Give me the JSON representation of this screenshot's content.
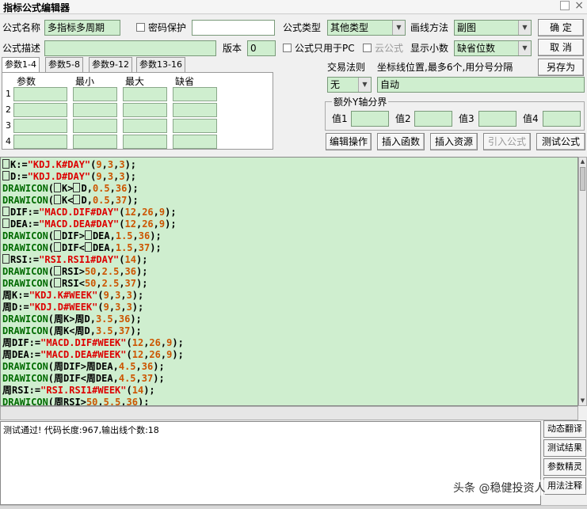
{
  "window": {
    "title": "指标公式编辑器"
  },
  "form": {
    "name_label": "公式名称",
    "name_value": "多指标多周期",
    "password_label": "密码保护",
    "desc_label": "公式描述",
    "version_label": "版本",
    "version_value": "0",
    "type_label": "公式类型",
    "type_value": "其他类型",
    "draw_label": "画线方法",
    "draw_value": "副图",
    "pc_only_label": "公式只用于PC",
    "cloud_label": "云公式",
    "decimals_label": "显示小数",
    "decimals_value": "缺省位数",
    "trade_rule_label": "交易法则",
    "trade_rule_value": "无",
    "coord_label": "坐标线位置,最多6个,用分号分隔",
    "coord_value": "自动",
    "yaxis_group": "额外Y轴分界",
    "val1_label": "值1",
    "val2_label": "值2",
    "val3_label": "值3",
    "val4_label": "值4"
  },
  "buttons": {
    "ok": "确  定",
    "cancel": "取  消",
    "save_as": "另存为",
    "edit_op": "编辑操作",
    "insert_fn": "插入函数",
    "insert_res": "插入资源",
    "import_formula": "引入公式",
    "test_formula": "测试公式"
  },
  "tabs": [
    "参数1-4",
    "参数5-8",
    "参数9-12",
    "参数13-16"
  ],
  "params": {
    "headers": [
      "参数",
      "最小",
      "最大",
      "缺省"
    ],
    "rows": [
      "1",
      "2",
      "3",
      "4"
    ]
  },
  "code_lines": [
    [
      [
        "box",
        ""
      ],
      [
        "id",
        "K:="
      ],
      [
        "str",
        "\"KDJ.K#DAY\""
      ],
      [
        "op",
        "("
      ],
      [
        "num",
        "9"
      ],
      [
        "op",
        ","
      ],
      [
        "num",
        "3"
      ],
      [
        "op",
        ","
      ],
      [
        "num",
        "3"
      ],
      [
        "op",
        ");"
      ]
    ],
    [
      [
        "box",
        ""
      ],
      [
        "id",
        "D:="
      ],
      [
        "str",
        "\"KDJ.D#DAY\""
      ],
      [
        "op",
        "("
      ],
      [
        "num",
        "9"
      ],
      [
        "op",
        ","
      ],
      [
        "num",
        "3"
      ],
      [
        "op",
        ","
      ],
      [
        "num",
        "3"
      ],
      [
        "op",
        ");"
      ]
    ],
    [
      [
        "fn",
        "DRAWICON"
      ],
      [
        "op",
        "("
      ],
      [
        "box",
        ""
      ],
      [
        "id",
        "K>"
      ],
      [
        "box",
        ""
      ],
      [
        "id",
        "D,"
      ],
      [
        "num",
        "0.5"
      ],
      [
        "op",
        ","
      ],
      [
        "num",
        "36"
      ],
      [
        "op",
        ");"
      ]
    ],
    [
      [
        "fn",
        "DRAWICON"
      ],
      [
        "op",
        "("
      ],
      [
        "box",
        ""
      ],
      [
        "id",
        "K<"
      ],
      [
        "box",
        ""
      ],
      [
        "id",
        "D,"
      ],
      [
        "num",
        "0.5"
      ],
      [
        "op",
        ","
      ],
      [
        "num",
        "37"
      ],
      [
        "op",
        ");"
      ]
    ],
    [
      [
        "box",
        ""
      ],
      [
        "id",
        "DIF:="
      ],
      [
        "str",
        "\"MACD.DIF#DAY\""
      ],
      [
        "op",
        "("
      ],
      [
        "num",
        "12"
      ],
      [
        "op",
        ","
      ],
      [
        "num",
        "26"
      ],
      [
        "op",
        ","
      ],
      [
        "num",
        "9"
      ],
      [
        "op",
        ");"
      ]
    ],
    [
      [
        "box",
        ""
      ],
      [
        "id",
        "DEA:="
      ],
      [
        "str",
        "\"MACD.DEA#DAY\""
      ],
      [
        "op",
        "("
      ],
      [
        "num",
        "12"
      ],
      [
        "op",
        ","
      ],
      [
        "num",
        "26"
      ],
      [
        "op",
        ","
      ],
      [
        "num",
        "9"
      ],
      [
        "op",
        ");"
      ]
    ],
    [
      [
        "fn",
        "DRAWICON"
      ],
      [
        "op",
        "("
      ],
      [
        "box",
        ""
      ],
      [
        "id",
        "DIF>"
      ],
      [
        "box",
        ""
      ],
      [
        "id",
        "DEA,"
      ],
      [
        "num",
        "1.5"
      ],
      [
        "op",
        ","
      ],
      [
        "num",
        "36"
      ],
      [
        "op",
        ");"
      ]
    ],
    [
      [
        "fn",
        "DRAWICON"
      ],
      [
        "op",
        "("
      ],
      [
        "box",
        ""
      ],
      [
        "id",
        "DIF<"
      ],
      [
        "box",
        ""
      ],
      [
        "id",
        "DEA,"
      ],
      [
        "num",
        "1.5"
      ],
      [
        "op",
        ","
      ],
      [
        "num",
        "37"
      ],
      [
        "op",
        ");"
      ]
    ],
    [
      [
        "box",
        ""
      ],
      [
        "id",
        "RSI:="
      ],
      [
        "str",
        "\"RSI.RSI1#DAY\""
      ],
      [
        "op",
        "("
      ],
      [
        "num",
        "14"
      ],
      [
        "op",
        ");"
      ]
    ],
    [
      [
        "fn",
        "DRAWICON"
      ],
      [
        "op",
        "("
      ],
      [
        "box",
        ""
      ],
      [
        "id",
        "RSI>"
      ],
      [
        "num",
        "50"
      ],
      [
        "op",
        ","
      ],
      [
        "num",
        "2.5"
      ],
      [
        "op",
        ","
      ],
      [
        "num",
        "36"
      ],
      [
        "op",
        ");"
      ]
    ],
    [
      [
        "fn",
        "DRAWICON"
      ],
      [
        "op",
        "("
      ],
      [
        "box",
        ""
      ],
      [
        "id",
        "RSI<"
      ],
      [
        "num",
        "50"
      ],
      [
        "op",
        ","
      ],
      [
        "num",
        "2.5"
      ],
      [
        "op",
        ","
      ],
      [
        "num",
        "37"
      ],
      [
        "op",
        ");"
      ]
    ],
    [
      [
        "id",
        "周K:="
      ],
      [
        "str",
        "\"KDJ.K#WEEK\""
      ],
      [
        "op",
        "("
      ],
      [
        "num",
        "9"
      ],
      [
        "op",
        ","
      ],
      [
        "num",
        "3"
      ],
      [
        "op",
        ","
      ],
      [
        "num",
        "3"
      ],
      [
        "op",
        ");"
      ]
    ],
    [
      [
        "id",
        "周D:="
      ],
      [
        "str",
        "\"KDJ.D#WEEK\""
      ],
      [
        "op",
        "("
      ],
      [
        "num",
        "9"
      ],
      [
        "op",
        ","
      ],
      [
        "num",
        "3"
      ],
      [
        "op",
        ","
      ],
      [
        "num",
        "3"
      ],
      [
        "op",
        ");"
      ]
    ],
    [
      [
        "fn",
        "DRAWICON"
      ],
      [
        "op",
        "("
      ],
      [
        "id",
        "周K>周D,"
      ],
      [
        "num",
        "3.5"
      ],
      [
        "op",
        ","
      ],
      [
        "num",
        "36"
      ],
      [
        "op",
        ");"
      ]
    ],
    [
      [
        "fn",
        "DRAWICON"
      ],
      [
        "op",
        "("
      ],
      [
        "id",
        "周K<周D,"
      ],
      [
        "num",
        "3.5"
      ],
      [
        "op",
        ","
      ],
      [
        "num",
        "37"
      ],
      [
        "op",
        ");"
      ]
    ],
    [
      [
        "id",
        "周DIF:="
      ],
      [
        "str",
        "\"MACD.DIF#WEEK\""
      ],
      [
        "op",
        "("
      ],
      [
        "num",
        "12"
      ],
      [
        "op",
        ","
      ],
      [
        "num",
        "26"
      ],
      [
        "op",
        ","
      ],
      [
        "num",
        "9"
      ],
      [
        "op",
        ");"
      ]
    ],
    [
      [
        "id",
        "周DEA:="
      ],
      [
        "str",
        "\"MACD.DEA#WEEK\""
      ],
      [
        "op",
        "("
      ],
      [
        "num",
        "12"
      ],
      [
        "op",
        ","
      ],
      [
        "num",
        "26"
      ],
      [
        "op",
        ","
      ],
      [
        "num",
        "9"
      ],
      [
        "op",
        ");"
      ]
    ],
    [
      [
        "fn",
        "DRAWICON"
      ],
      [
        "op",
        "("
      ],
      [
        "id",
        "周DIF>周DEA,"
      ],
      [
        "num",
        "4.5"
      ],
      [
        "op",
        ","
      ],
      [
        "num",
        "36"
      ],
      [
        "op",
        ");"
      ]
    ],
    [
      [
        "fn",
        "DRAWICON"
      ],
      [
        "op",
        "("
      ],
      [
        "id",
        "周DIF<周DEA,"
      ],
      [
        "num",
        "4.5"
      ],
      [
        "op",
        ","
      ],
      [
        "num",
        "37"
      ],
      [
        "op",
        ");"
      ]
    ],
    [
      [
        "id",
        "周RSI:="
      ],
      [
        "str",
        "\"RSI.RSI1#WEEK\""
      ],
      [
        "op",
        "("
      ],
      [
        "num",
        "14"
      ],
      [
        "op",
        ");"
      ]
    ],
    [
      [
        "fn",
        "DRAWICON"
      ],
      [
        "op",
        "("
      ],
      [
        "id",
        "周RSI>"
      ],
      [
        "num",
        "50"
      ],
      [
        "op",
        ","
      ],
      [
        "num",
        "5.5"
      ],
      [
        "op",
        ","
      ],
      [
        "num",
        "36"
      ],
      [
        "op",
        ");"
      ]
    ]
  ],
  "output": {
    "text": "测试通过! 代码长度:967,输出线个数:18"
  },
  "side_buttons": [
    "动态翻译",
    "测试结果",
    "参数精灵",
    "用法注释"
  ],
  "watermark": "头条 @稳健投资人"
}
